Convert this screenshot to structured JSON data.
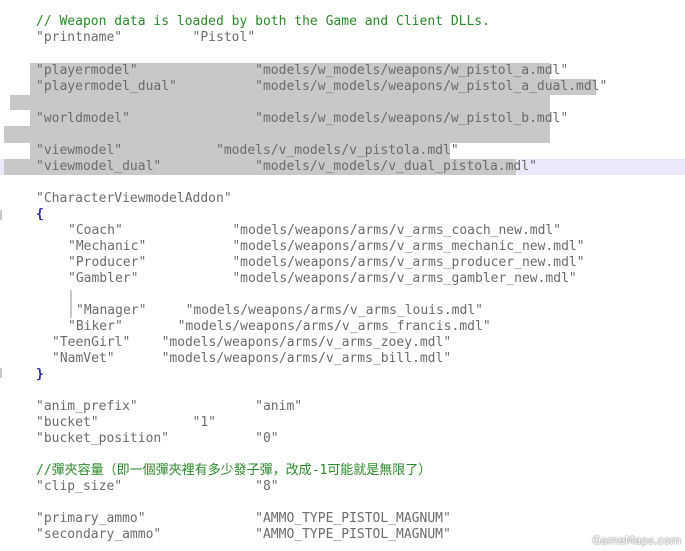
{
  "editor": {
    "lines": [
      "// Weapon data is loaded by both the Game and Client DLLs.",
      "\"printname\"         \"Pistol\"",
      "\"playermodel\"               \"models/w_models/weapons/w_pistol_a.mdl\"",
      "\"playermodel_dual\"          \"models/w_models/weapons/w_pistol_a_dual.mdl\"",
      "\"worldmodel\"                \"models/w_models/weapons/w_pistol_b.mdl\"",
      "\"viewmodel\"            \"models/v_models/v_pistola.mdl\"",
      "\"viewmodel_dual\"            \"models/v_models/v_dual_pistola.mdl\"",
      "\"CharacterViewmodelAddon\"",
      "{",
      "\"Coach\"              \"models/weapons/arms/v_arms_coach_new.mdl\"",
      "\"Mechanic\"           \"models/weapons/arms/v_arms_mechanic_new.mdl\"",
      "\"Producer\"           \"models/weapons/arms/v_arms_producer_new.mdl\"",
      "\"Gambler\"            \"models/weapons/arms/v_arms_gambler_new.mdl\"",
      "\"Manager\"     \"models/weapons/arms/v_arms_louis.mdl\"",
      "\"Biker\"       \"models/weapons/arms/v_arms_francis.mdl\"",
      "\"TeenGirl\"    \"models/weapons/arms/v_arms_zoey.mdl\"",
      "\"NamVet\"      \"models/weapons/arms/v_arms_bill.mdl\"",
      "}",
      "\"anim_prefix\"               \"anim\"",
      "\"bucket\"            \"1\"",
      "\"bucket_position\"           \"0\"",
      "//彈夾容量（即一個彈夾裡有多少發子彈，改成-1可能就是無限了）",
      "\"clip_size\"                 \"8\"",
      "\"primary_ammo\"              \"AMMO_TYPE_PISTOL_MAGNUM\"",
      "\"secondary_ammo\"            \"AMMO_TYPE_PISTOL_MAGNUM\""
    ]
  },
  "watermark": "GameMaps.com",
  "colors": {
    "text": "#6b6b6b",
    "comment": "#2a8a2a",
    "brace": "#2a2aa8",
    "selection": "#c8c8c8",
    "current_line": "#e9e9fb"
  }
}
